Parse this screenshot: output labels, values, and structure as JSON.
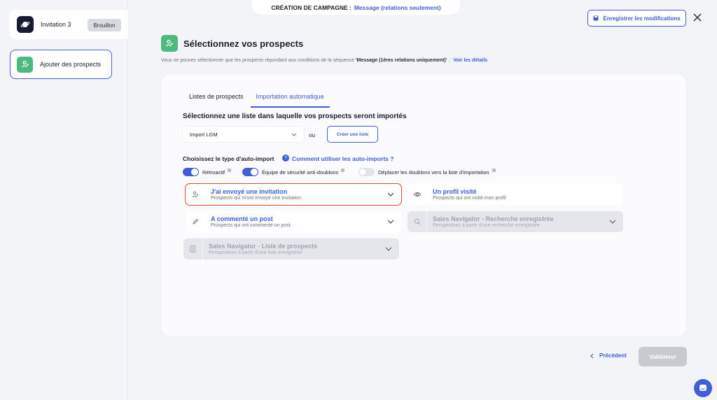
{
  "sidebar": {
    "campaign_name": "Invitation 3",
    "campaign_status": "Brouillon",
    "step_label": "Ajouter des prospects"
  },
  "topbar": {
    "label": "CRÉATION DE CAMPAGNE :",
    "value": "Message (relations seulement)",
    "save_label": "Enregistrer les modifications"
  },
  "header": {
    "title": "Sélectionnez vos prospects",
    "subtitle_pre": "Vous ne pouvez sélectionner que les prospects répondant aux conditions de la séquence",
    "subtitle_bold": "'Message (1ères relations uniquement)'",
    "subtitle_post": ".",
    "details_link": "Voir les détails"
  },
  "tabs": [
    {
      "label": "Listes de prospects"
    },
    {
      "label": "Importation automatique"
    }
  ],
  "list_section": {
    "title": "Sélectionnez une liste dans laquelle vos prospects seront importés",
    "selected_list": "Import LGM",
    "or_label": "ou",
    "create_label": "Créer une liste"
  },
  "autoimport": {
    "label": "Choisissez le type d'auto-import",
    "help_link": "Comment utiliser les auto-imports ?",
    "toggles": [
      {
        "label": "Rétroactif",
        "on": true
      },
      {
        "label": "Équipe de sécurité anti-doublons",
        "on": true
      },
      {
        "label": "Déplacer les doublons vers la liste d'importation",
        "on": false
      }
    ],
    "options": [
      {
        "title": "J'ai envoyé une invitation",
        "desc": "Prospects qui m'ont envoyé une invitation",
        "icon": "user-plus-icon",
        "state": "selected"
      },
      {
        "title": "Un profil visité",
        "desc": "Prospects qui ont visité mon profil",
        "icon": "eye-icon",
        "state": "enabled"
      },
      {
        "title": "A commenté un post",
        "desc": "Prospects qui ont commenté un post",
        "icon": "pencil-icon",
        "state": "enabled"
      },
      {
        "title": "Sales Navigator - Recherche enregistrée",
        "desc": "Perspectives à partir d'une recherche enregistrée",
        "icon": "search-icon",
        "state": "disabled"
      },
      {
        "title": "Sales Navigator - Liste de prospects",
        "desc": "Perspectives à partir d'une liste enregistrée",
        "icon": "document-icon",
        "state": "disabled"
      }
    ]
  },
  "footer": {
    "prev_label": "Précédent",
    "validate_label": "Validateur"
  },
  "colors": {
    "accent": "#3f5ed8",
    "green": "#4cba7f",
    "selected_outline": "#e24a34"
  }
}
